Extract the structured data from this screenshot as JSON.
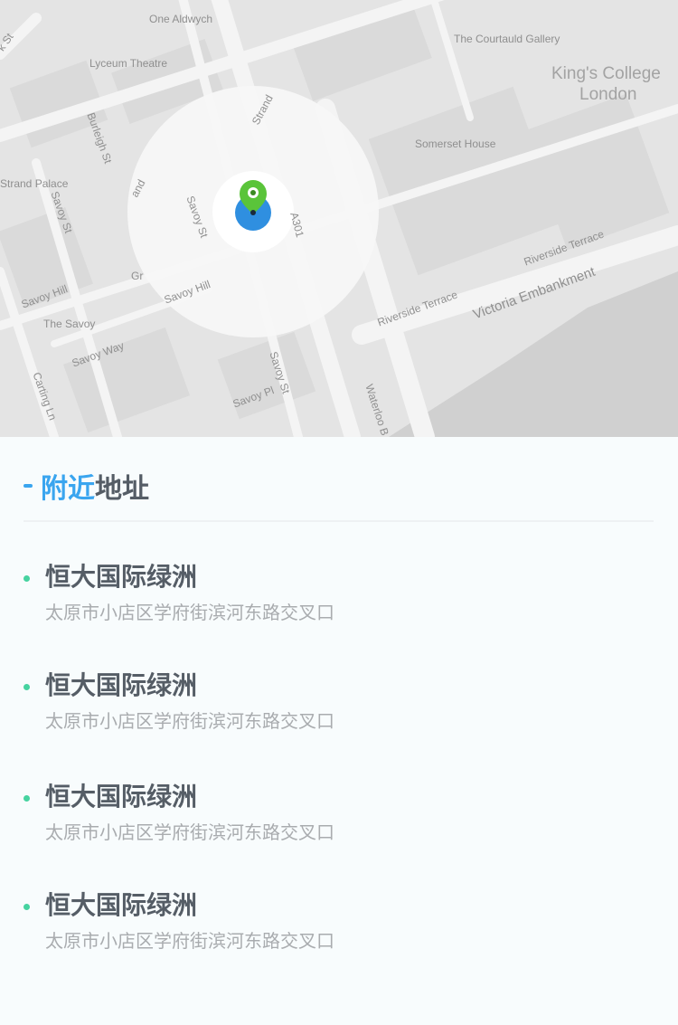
{
  "map": {
    "labels": {
      "one_aldwych": "One Aldwych",
      "lyceum": "Lyceum Theatre",
      "courtauld": "The Courtauld Gallery",
      "kings_college_line1": "King's College",
      "kings_college_line2": "London",
      "somerset": "Somerset House",
      "burleigh": "Burleigh St",
      "strand_palace": "Strand Palace",
      "savoy_st": "Savoy St",
      "strand": "Strand",
      "strand_partial": "and",
      "savoy_hill_left": "Savoy Hill",
      "savoy_hill_center": "Savoy Hill",
      "the_savoy": "The Savoy",
      "savoy_way": "Savoy Way",
      "carting": "Carting Ln",
      "savoy_pl": "Savoy Pl",
      "savoy_st_lower": "Savoy St",
      "waterloo": "Waterloo B",
      "a301": "A301",
      "riverside_terrace_1": "Riverside Terrace",
      "riverside_terrace_2": "Riverside Terrace",
      "victoria": "Victoria Embankment",
      "gr": "Gr",
      "st": "k St"
    },
    "pin_colors": {
      "outer": "#5ac43a",
      "current": "#2f8fe0"
    }
  },
  "section": {
    "title_accent": "附近",
    "title_rest": "地址"
  },
  "addresses": [
    {
      "name": "恒大国际绿洲",
      "address": "太原市小店区学府街滨河东路交叉口"
    },
    {
      "name": "恒大国际绿洲",
      "address": "太原市小店区学府街滨河东路交叉口"
    },
    {
      "name": "恒大国际绿洲",
      "address": "太原市小店区学府街滨河东路交叉口"
    },
    {
      "name": "恒大国际绿洲",
      "address": "太原市小店区学府街滨河东路交叉口"
    }
  ],
  "colors": {
    "accent": "#3aa5ef",
    "bullet": "#46d3a0",
    "title": "#555d66",
    "address": "#a9acaf"
  }
}
